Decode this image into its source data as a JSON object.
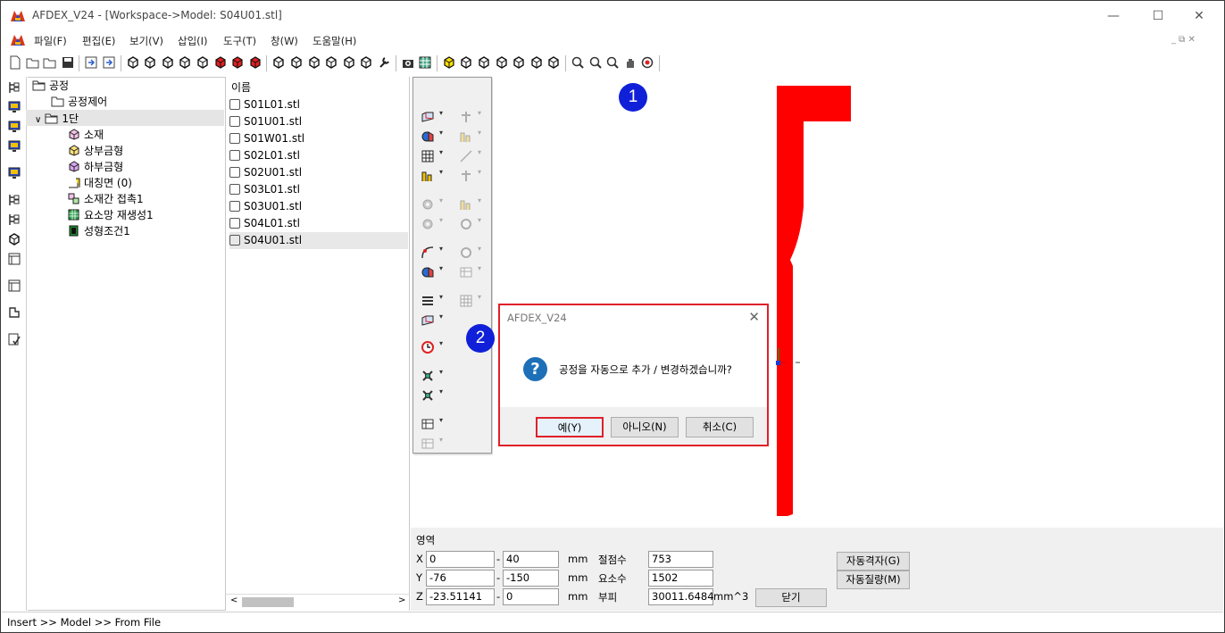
{
  "window": {
    "title": "AFDEX_V24 - [Workspace->Model: S04U01.stl]",
    "controls": {
      "minimize": "—",
      "maximize": "☐",
      "close": "✕"
    }
  },
  "menubar": {
    "items": [
      "파일(F)",
      "편집(E)",
      "보기(V)",
      "삽입(I)",
      "도구(T)",
      "창(W)",
      "도움말(H)"
    ],
    "mdi_controls": "_ ⧉ ✕"
  },
  "tree": {
    "items": [
      {
        "label": "공정",
        "icon": "folder-open-icon"
      },
      {
        "label": "공정제어",
        "icon": "folder-icon"
      },
      {
        "label": "1단",
        "icon": "folder-open-icon",
        "expander": "∨"
      },
      {
        "label": "소재",
        "icon": "material-cube-icon"
      },
      {
        "label": "상부금형",
        "icon": "upper-die-icon"
      },
      {
        "label": "하부금형",
        "icon": "lower-die-icon"
      },
      {
        "label": "대칭면 (0)",
        "icon": "symmetry-plane-icon"
      },
      {
        "label": "소재간 접촉1",
        "icon": "contact-icon"
      },
      {
        "label": "요소망 재생성1",
        "icon": "remesh-icon"
      },
      {
        "label": "성형조건1",
        "icon": "forming-condition-icon"
      }
    ]
  },
  "filelist": {
    "header": "이름",
    "files": [
      "S01L01.stl",
      "S01U01.stl",
      "S01W01.stl",
      "S02L01.stl",
      "S02U01.stl",
      "S03L01.stl",
      "S03U01.stl",
      "S04L01.stl",
      "S04U01.stl"
    ],
    "selected": "S04U01.stl",
    "scroll_left": "<",
    "scroll_right": ">"
  },
  "palette": {
    "dropdown_glyph": "▾"
  },
  "info": {
    "title": "영역",
    "x_label": "X",
    "x_min": "0",
    "x_max": "40",
    "y_label": "Y",
    "y_min": "-76",
    "y_max": "-150",
    "z_label": "Z",
    "z_min": "-23.51141",
    "z_max": "0",
    "dash": "-",
    "unit": "mm",
    "nodes_label": "절점수",
    "nodes": "753",
    "elements_label": "요소수",
    "elements": "1502",
    "volume_label": "부피",
    "volume": "30011.6484",
    "volume_unit": "mm^3",
    "auto_mesh_button": "자동격자(G)",
    "auto_mass_button": "자동질량(M)",
    "close_button": "닫기"
  },
  "dialog": {
    "title": "AFDEX_V24",
    "close": "✕",
    "icon": "?",
    "message": "공정을 자동으로 추가 / 변경하겠습니까?",
    "yes": "예(Y)",
    "no": "아니오(N)",
    "cancel": "취소(C)"
  },
  "badges": {
    "step1": "1",
    "step2": "2"
  },
  "status": {
    "text": "Insert >> Model >> From File"
  },
  "colors": {
    "model_red": "#ff0000",
    "badge_blue": "#1020d8",
    "highlight_red": "#e0202b"
  }
}
